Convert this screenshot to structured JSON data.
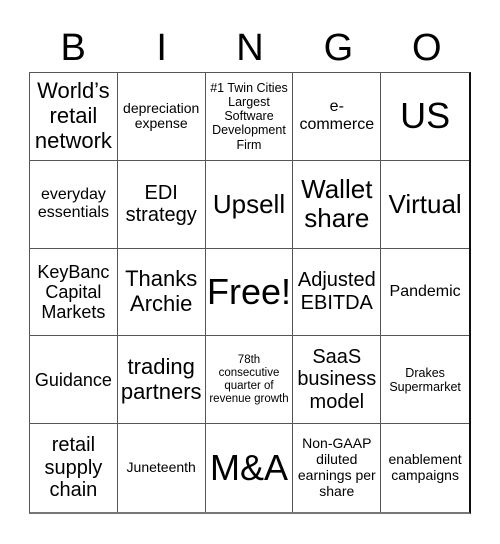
{
  "header": {
    "letters": [
      "B",
      "I",
      "N",
      "G",
      "O"
    ]
  },
  "cells": [
    "World’s retail network",
    "depreciation expense",
    "#1 Twin Cities Largest Software Development Firm",
    "e-commerce",
    "US",
    "everyday essentials",
    "EDI strategy",
    "Upsell",
    "Wallet share",
    "Virtual",
    "KeyBanc Capital Markets",
    "Thanks Archie",
    "Free!",
    "Adjusted EBITDA",
    "Pandemic",
    "Guidance",
    "trading partners",
    "78th consecutive quarter of revenue growth",
    "SaaS business model",
    "Drakes Supermarket",
    "retail supply chain",
    "Juneteenth",
    "M&A",
    "Non-GAAP diluted earnings per share",
    "enablement campaigns"
  ]
}
